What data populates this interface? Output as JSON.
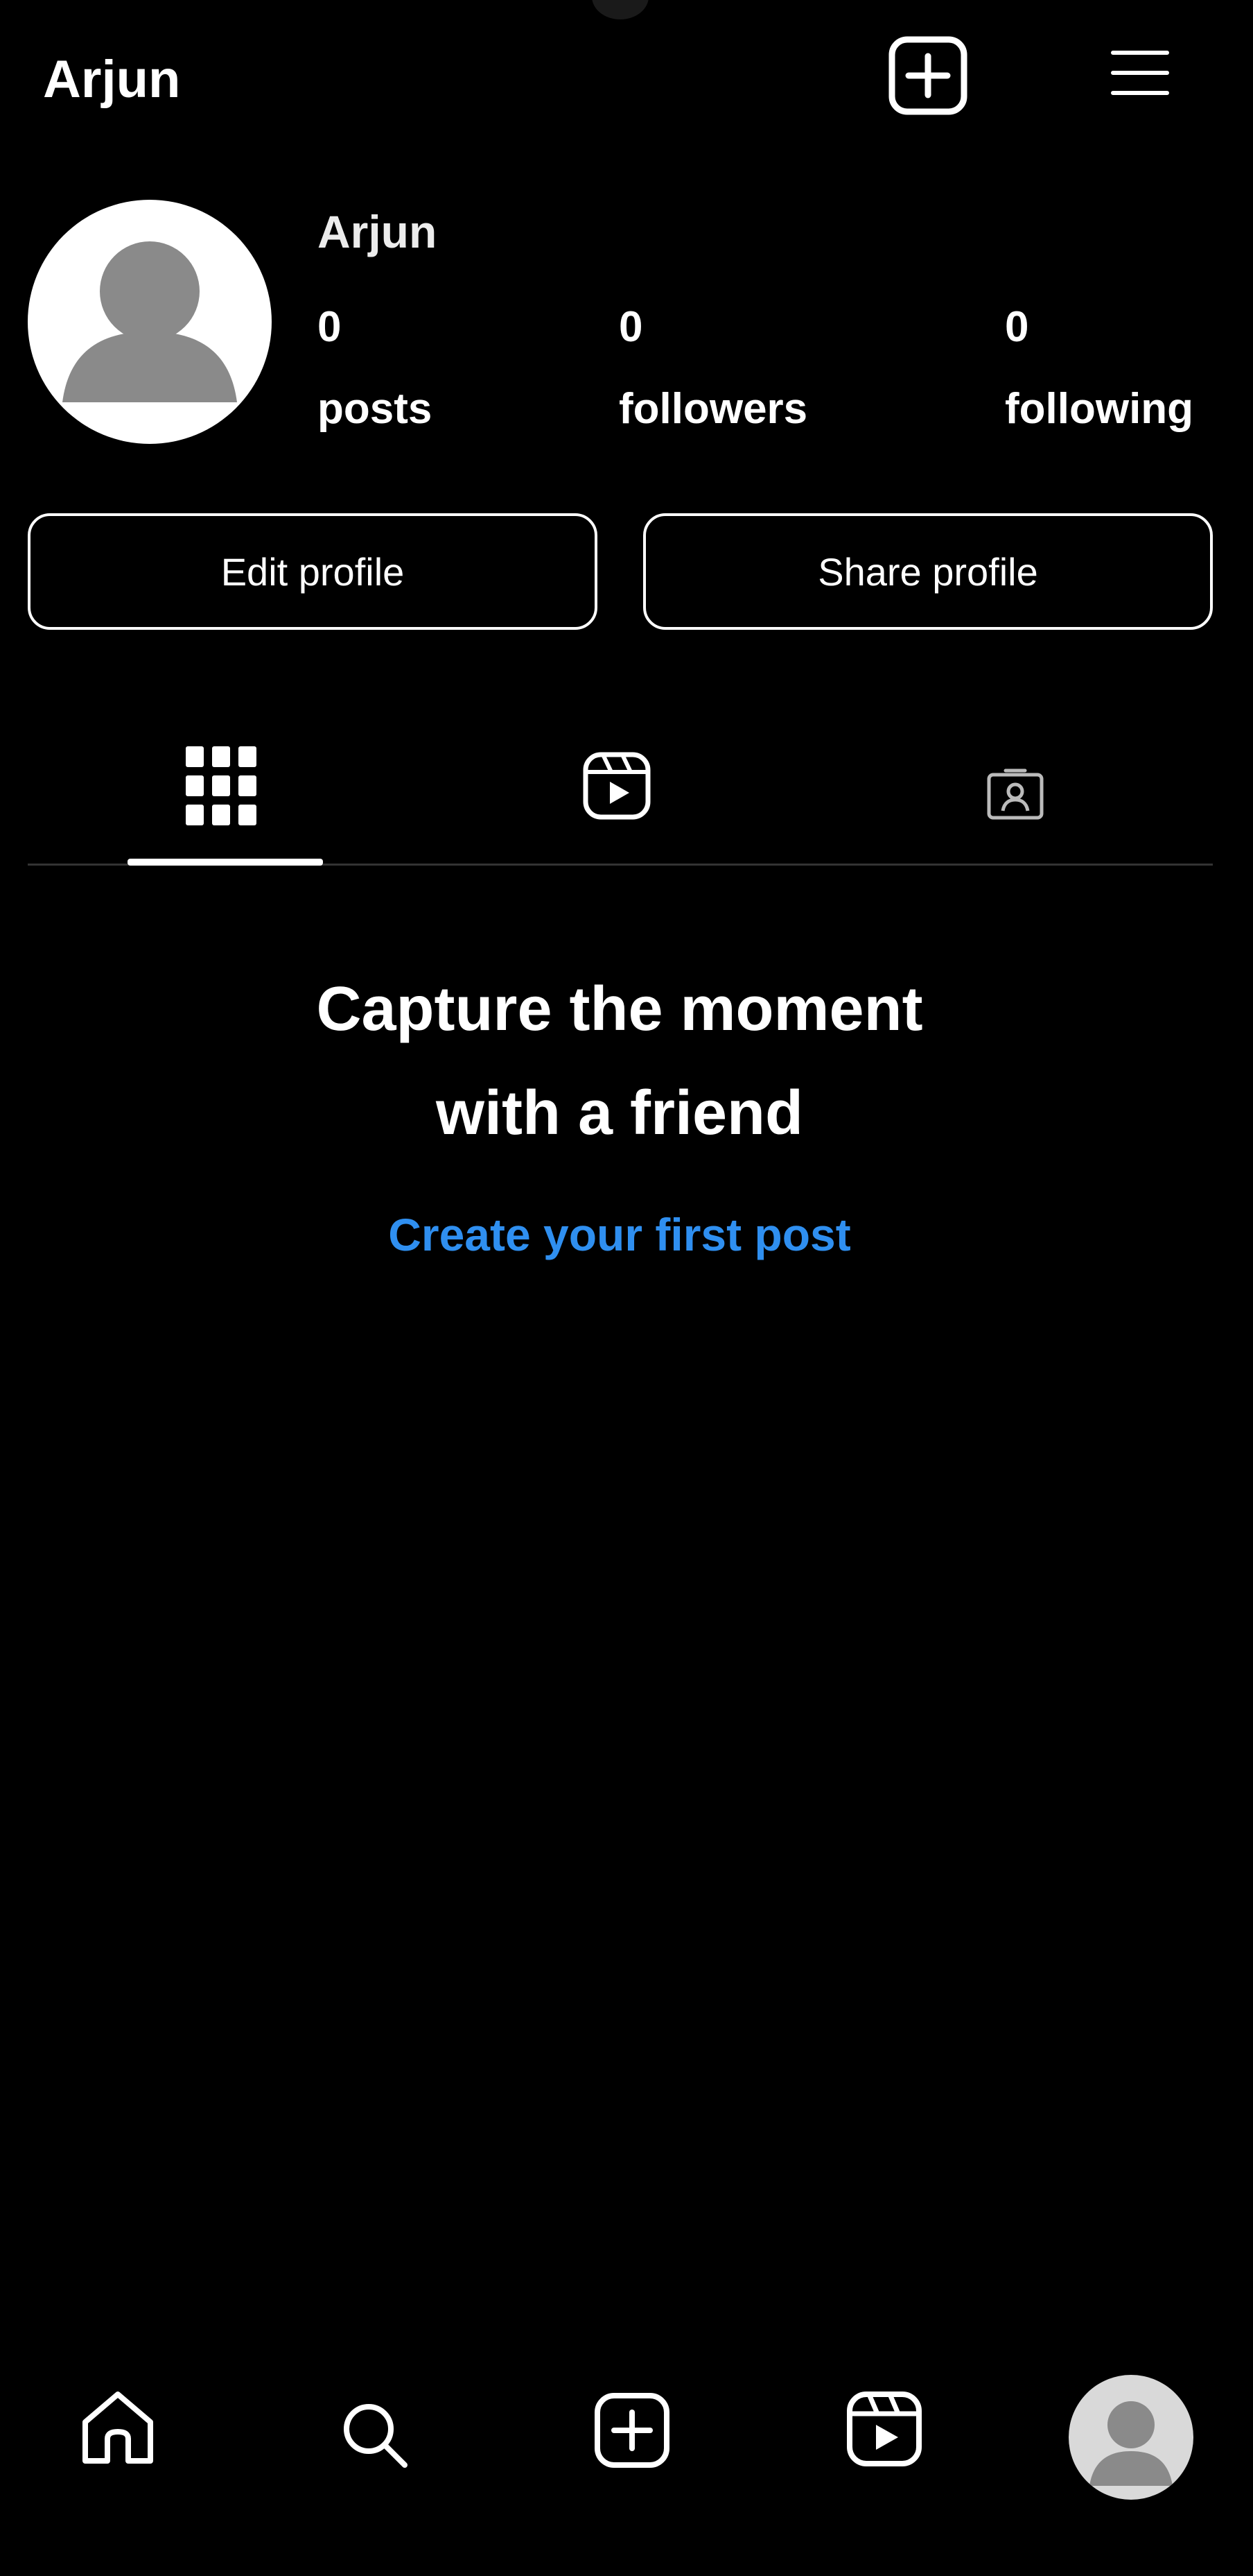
{
  "header": {
    "username": "Arjun",
    "create_icon": "plus-square-icon",
    "menu_icon": "hamburger-menu-icon"
  },
  "profile": {
    "name": "Arjun",
    "avatar_icon": "default-avatar-icon",
    "stats": [
      {
        "count": "0",
        "label": "posts"
      },
      {
        "count": "0",
        "label": "followers"
      },
      {
        "count": "0",
        "label": "following"
      }
    ]
  },
  "actions": {
    "edit_label": "Edit profile",
    "share_label": "Share profile"
  },
  "tabs": [
    {
      "name": "grid-icon",
      "active": true
    },
    {
      "name": "reels-icon",
      "active": false
    },
    {
      "name": "tagged-icon",
      "active": false
    }
  ],
  "empty_state": {
    "title_line1": "Capture the moment",
    "title_line2": "with a friend",
    "cta": "Create your first post"
  },
  "bottom_nav": [
    {
      "name": "home-icon"
    },
    {
      "name": "search-icon"
    },
    {
      "name": "create-icon"
    },
    {
      "name": "reels-icon"
    },
    {
      "name": "profile-avatar-icon"
    }
  ],
  "colors": {
    "background": "#000000",
    "text": "#ffffff",
    "link": "#2f8ff0",
    "avatar_bg": "#ffffff",
    "avatar_silhouette": "#8a8a8a"
  }
}
